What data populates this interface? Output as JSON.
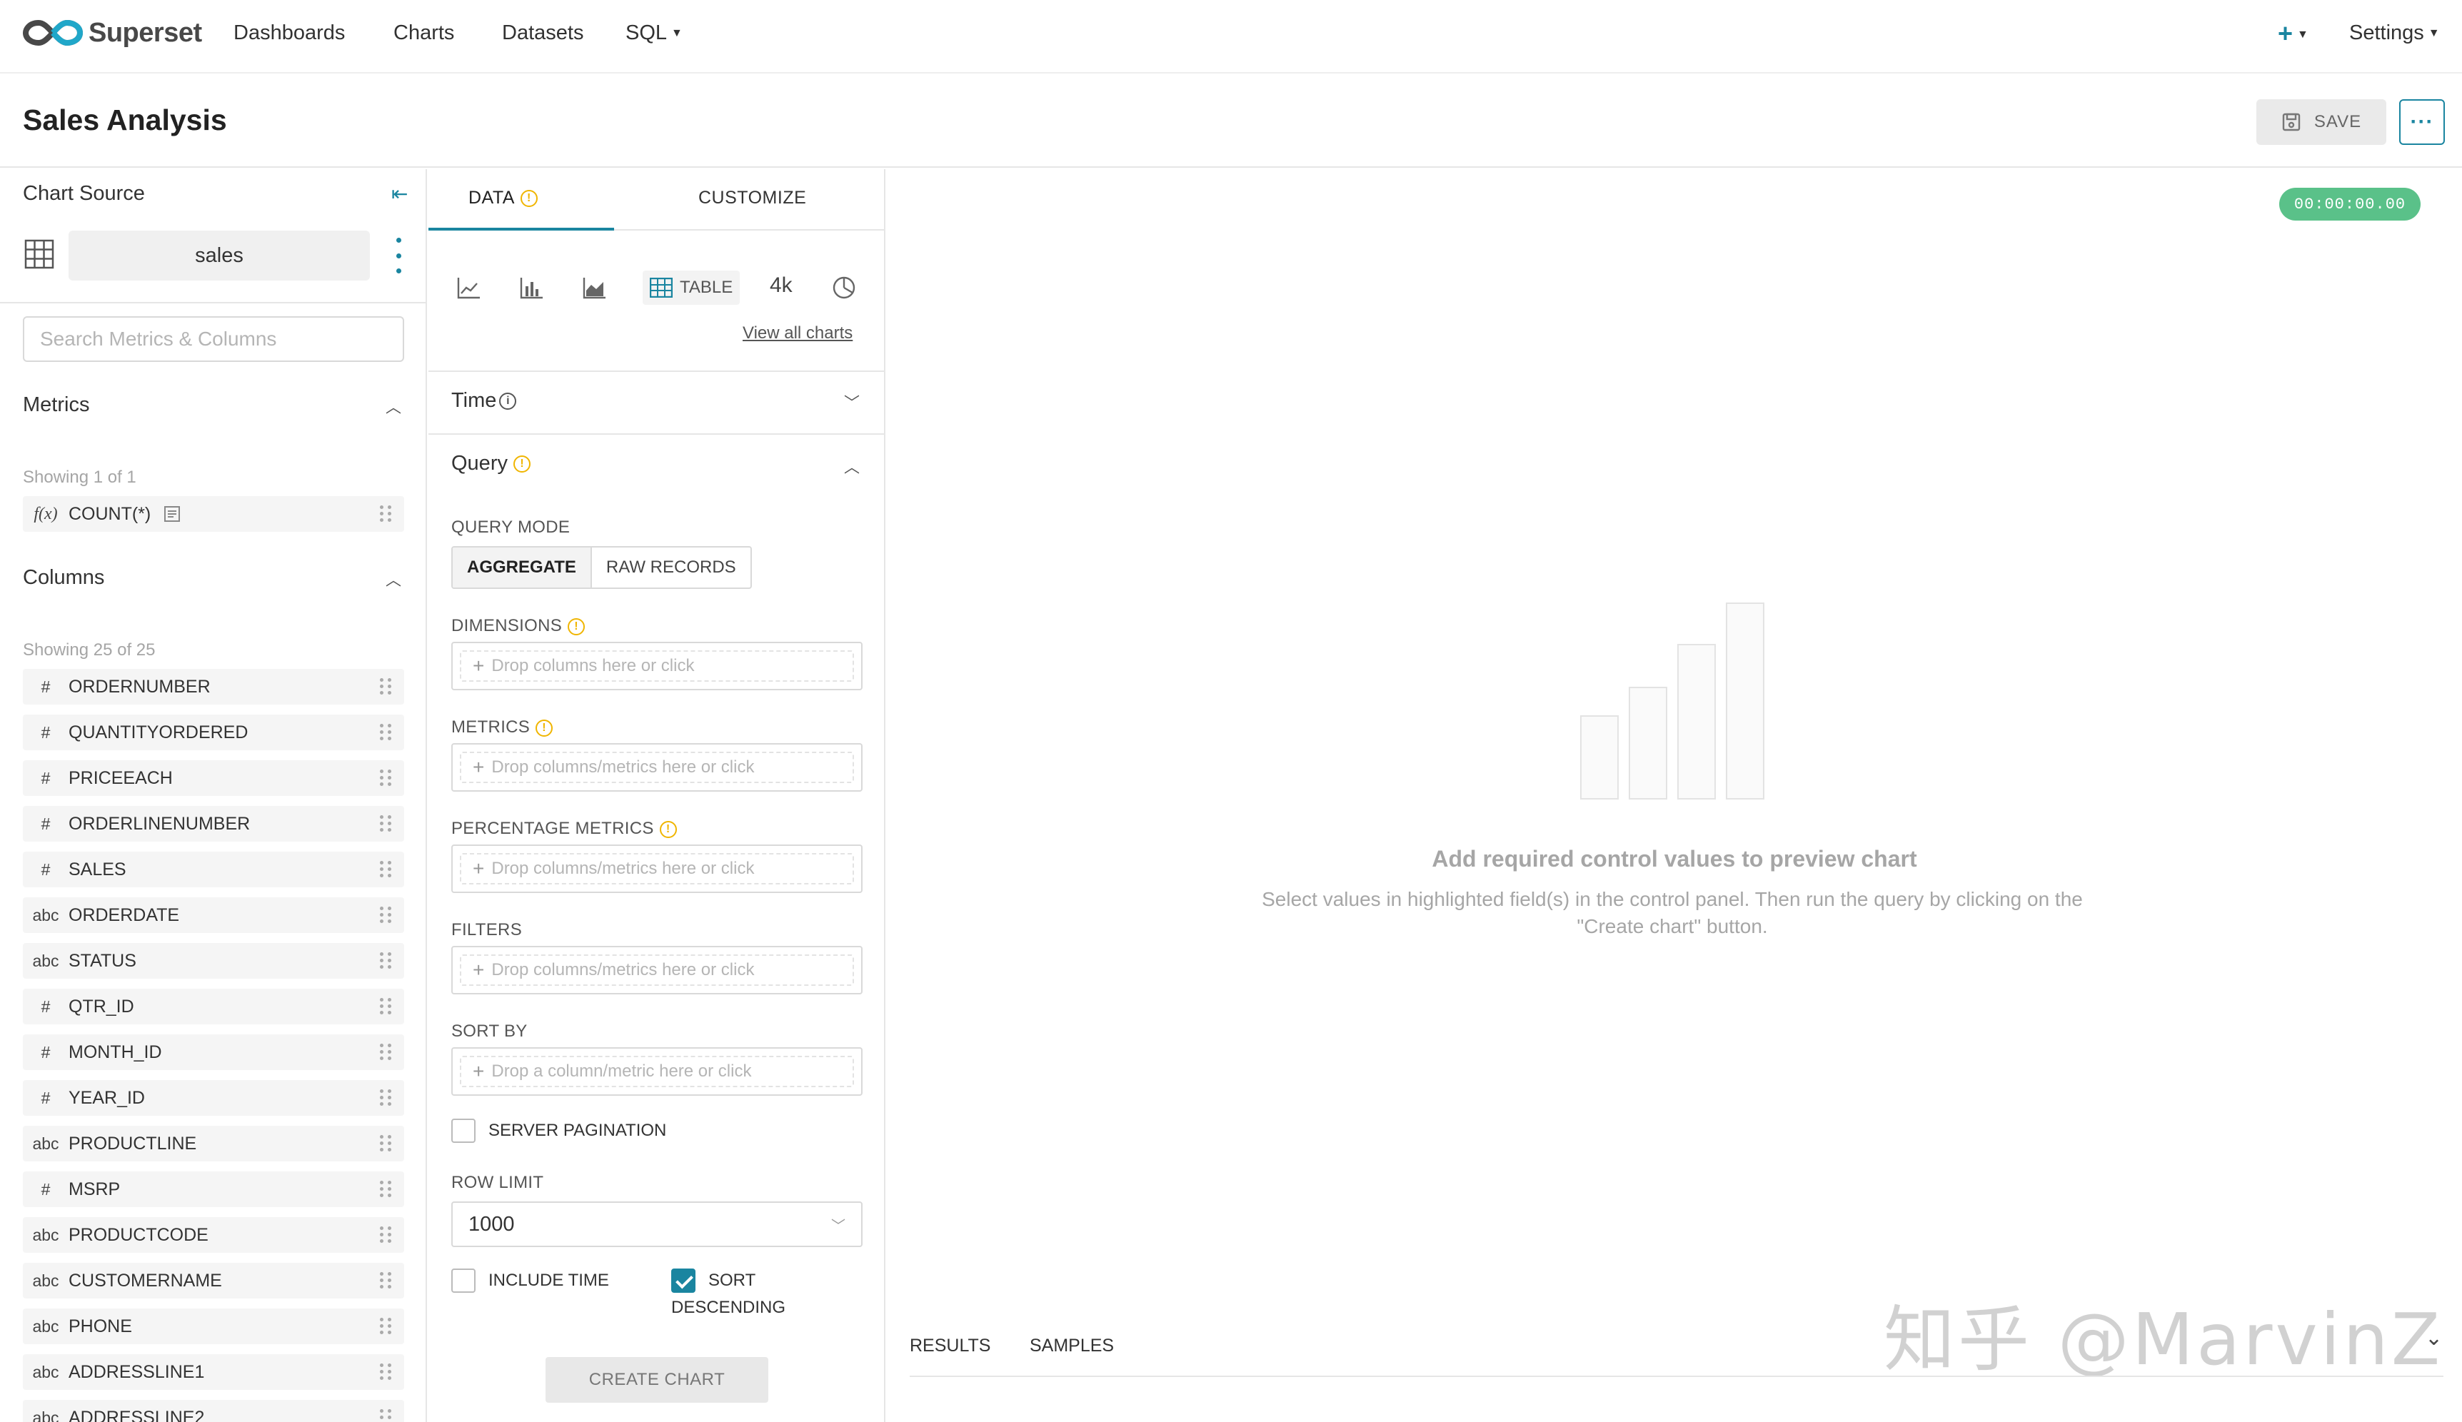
{
  "app": {
    "brand": "Superset",
    "nav": [
      "Dashboards",
      "Charts",
      "Datasets",
      "SQL"
    ],
    "settings_label": "Settings"
  },
  "header": {
    "title": "Sales Analysis",
    "save_label": "SAVE",
    "more_label": "···"
  },
  "datasource": {
    "section_label": "Chart Source",
    "name": "sales",
    "search_placeholder": "Search Metrics & Columns",
    "metrics_title": "Metrics",
    "metrics_showing": "Showing 1 of 1",
    "metrics": [
      {
        "type": "f(x)",
        "name": "COUNT(*)"
      }
    ],
    "columns_title": "Columns",
    "columns_showing": "Showing 25 of 25",
    "columns": [
      {
        "type": "#",
        "name": "ORDERNUMBER"
      },
      {
        "type": "#",
        "name": "QUANTITYORDERED"
      },
      {
        "type": "#",
        "name": "PRICEEACH"
      },
      {
        "type": "#",
        "name": "ORDERLINENUMBER"
      },
      {
        "type": "#",
        "name": "SALES"
      },
      {
        "type": "abc",
        "name": "ORDERDATE"
      },
      {
        "type": "abc",
        "name": "STATUS"
      },
      {
        "type": "#",
        "name": "QTR_ID"
      },
      {
        "type": "#",
        "name": "MONTH_ID"
      },
      {
        "type": "#",
        "name": "YEAR_ID"
      },
      {
        "type": "abc",
        "name": "PRODUCTLINE"
      },
      {
        "type": "#",
        "name": "MSRP"
      },
      {
        "type": "abc",
        "name": "PRODUCTCODE"
      },
      {
        "type": "abc",
        "name": "CUSTOMERNAME"
      },
      {
        "type": "abc",
        "name": "PHONE"
      },
      {
        "type": "abc",
        "name": "ADDRESSLINE1"
      },
      {
        "type": "abc",
        "name": "ADDRESSLINE2"
      }
    ]
  },
  "controls": {
    "tabs": [
      "DATA",
      "CUSTOMIZE"
    ],
    "active_tab": "DATA",
    "viz_types": [
      "line-chart-icon",
      "bar-chart-icon",
      "area-chart-icon",
      "TABLE",
      "4k",
      "pie-chart-icon"
    ],
    "selected_viz": "TABLE",
    "big_number_label": "4k",
    "view_all": "View all charts",
    "time_section": "Time",
    "query_section": "Query",
    "query_mode_label": "QUERY MODE",
    "query_modes": [
      "AGGREGATE",
      "RAW RECORDS"
    ],
    "selected_query_mode": "AGGREGATE",
    "dimensions_label": "DIMENSIONS",
    "dimensions_placeholder": "Drop columns here or click",
    "metrics_label": "METRICS",
    "metrics_placeholder": "Drop columns/metrics here or click",
    "percentage_metrics_label": "PERCENTAGE METRICS",
    "percentage_metrics_placeholder": "Drop columns/metrics here or click",
    "filters_label": "FILTERS",
    "filters_placeholder": "Drop columns/metrics here or click",
    "sort_by_label": "SORT BY",
    "sort_by_placeholder": "Drop a column/metric here or click",
    "server_pagination_label": "SERVER PAGINATION",
    "server_pagination_checked": false,
    "row_limit_label": "ROW LIMIT",
    "row_limit_value": "1000",
    "include_time_label": "INCLUDE TIME",
    "include_time_checked": false,
    "sort_descending_label_1": "SORT",
    "sort_descending_label_2": "DESCENDING",
    "sort_descending_checked": true,
    "create_chart_label": "CREATE CHART"
  },
  "preview": {
    "timer": "00:00:00.00",
    "empty_title": "Add required control values to preview chart",
    "empty_desc": "Select values in highlighted field(s) in the control panel. Then run the query by clicking on the \"Create chart\" button.",
    "result_tabs": [
      "RESULTS",
      "SAMPLES"
    ],
    "watermark": "知乎 @MarvinZ"
  },
  "colors": {
    "primary": "#1a85a0",
    "timer_green": "#5ac189",
    "info_yellow": "#f0b500"
  }
}
